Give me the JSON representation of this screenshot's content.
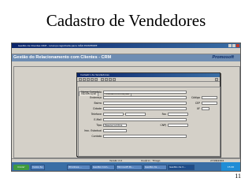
{
  "slide": {
    "title": "Cadastro de Vendedores",
    "page_number": "11"
  },
  "app": {
    "window_title": "Gestão de Clientes CRM - Licença registrada para: NÃO EXISTENTE",
    "menu": [
      "Cadastros",
      "Movimentação",
      "Vendas",
      "Relatórios",
      "Ajuda",
      "Sair"
    ],
    "banner_title": "Gestão do Relacionamento com Clientes - CRM",
    "logo_text": "Promosoft",
    "tabs": [
      "Identificação",
      "Dados Operacionais"
    ]
  },
  "dialog": {
    "title": "Cadastro de Vendedores",
    "tabs": [
      "Identificação",
      "Outras Informações"
    ],
    "fields": {
      "nome_completo": {
        "label": "Nome Completo",
        "value": ""
      },
      "endereco": {
        "label": "Endereço",
        "value": ""
      },
      "codigo": {
        "label": "Código",
        "value": ""
      },
      "bairro": {
        "label": "Bairro",
        "value": ""
      },
      "cep": {
        "label": "CEP",
        "value": ""
      },
      "cidade": {
        "label": "Cidade",
        "value": ""
      },
      "uf": {
        "label": "UF",
        "value": ""
      },
      "telefone": {
        "label": "Telefone",
        "value": ""
      },
      "fax": {
        "label": "Fax",
        "value": ""
      },
      "email": {
        "label": "E-Mail",
        "value": ""
      },
      "tipo": {
        "label": "Tipo",
        "value": "Pessoa Jurídica"
      },
      "cnpj": {
        "label": "CNPJ",
        "value": ""
      },
      "insc_estadual": {
        "label": "Insc. Estadual",
        "value": ""
      },
      "contato": {
        "label": "Contato",
        "value": ""
      }
    }
  },
  "statusbar": {
    "left": "",
    "middle": "Versão 2.0",
    "user": "Usuário : Thiago",
    "date": "27/08/2004"
  },
  "taskbar": {
    "start": "Iniciar",
    "tasks": [
      "Caixa de ...",
      "Windows ...",
      "Gestão Com...",
      "Microsoft Po...",
      "Gestão de ...",
      "Gestão de C..."
    ],
    "active_index": 5,
    "tray_time": "15:00"
  },
  "colors": {
    "titlebar": "#0a246a",
    "banner": "#6e8db3",
    "window_bg": "#d4d0c8",
    "taskbar": "#3a6ea5"
  }
}
